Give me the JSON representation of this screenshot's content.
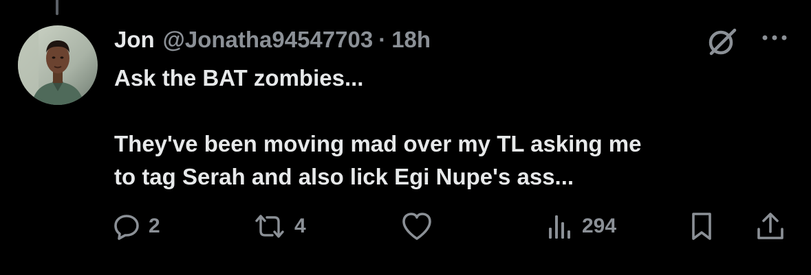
{
  "post": {
    "author_name": "Jon",
    "handle": "@Jonatha94547703",
    "separator": "·",
    "time": "18h",
    "text_line1": "Ask the BAT zombies...",
    "text_line2": "They've been moving mad over my TL asking me",
    "text_line3": "to tag Serah and also lick Egi Nupe's ass..."
  },
  "actions": {
    "replies": "2",
    "reposts": "4",
    "views": "294"
  },
  "icons": {
    "grok": "grok-icon",
    "more": "more-icon",
    "reply": "reply-icon",
    "repost": "repost-icon",
    "like": "heart-icon",
    "views": "views-icon",
    "bookmark": "bookmark-icon",
    "share": "share-icon"
  },
  "colors": {
    "background": "#000000",
    "primary_text": "#e7e9ea",
    "secondary_text": "#8b9096"
  }
}
